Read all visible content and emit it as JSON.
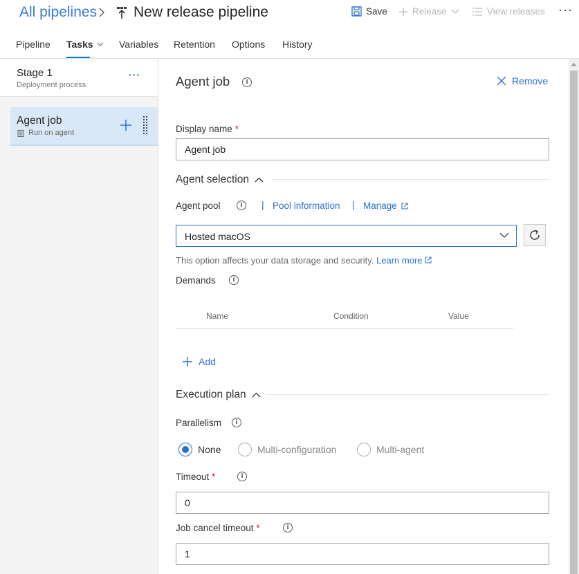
{
  "header": {
    "breadcrumb": "All pipelines",
    "title": "New release pipeline",
    "save_label": "Save",
    "release_label": "Release",
    "view_releases_label": "View releases",
    "more_label": "···"
  },
  "tabs": [
    {
      "label": "Pipeline"
    },
    {
      "label": "Tasks"
    },
    {
      "label": "Variables"
    },
    {
      "label": "Retention"
    },
    {
      "label": "Options"
    },
    {
      "label": "History"
    }
  ],
  "stage": {
    "title": "Stage 1",
    "subtitle": "Deployment process",
    "more": "···"
  },
  "job": {
    "title": "Agent job",
    "subtitle": "Run on agent"
  },
  "panel": {
    "heading": "Agent job",
    "remove_label": "Remove",
    "display_name_label": "Display name",
    "display_name_value": "Agent job",
    "agent_selection_label": "Agent selection",
    "agent_pool_label": "Agent pool",
    "pool_information_link": "Pool information",
    "manage_link": "Manage",
    "agent_pool_value": "Hosted macOS",
    "hint_text": "This option affects your data storage and security.",
    "learn_more_link": "Learn more",
    "demands_label": "Demands",
    "demands_columns": [
      "Name",
      "Condition",
      "Value"
    ],
    "add_label": "Add",
    "execution_plan_label": "Execution plan",
    "parallelism_label": "Parallelism",
    "parallelism_options": [
      "None",
      "Multi-configuration",
      "Multi-agent"
    ],
    "parallelism_selected": "None",
    "timeout_label": "Timeout",
    "timeout_value": "0",
    "job_cancel_timeout_label": "Job cancel timeout",
    "job_cancel_timeout_value": "1",
    "required_marker": "*",
    "info_glyph": "i"
  },
  "colors": {
    "accent": "#2a6fd6",
    "selected_item": "#d9e8f6",
    "required": "#c4262e"
  }
}
